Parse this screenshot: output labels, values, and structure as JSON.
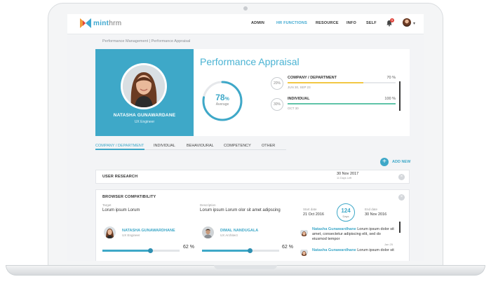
{
  "brand": {
    "name_a": "mint",
    "name_b": "hrm"
  },
  "nav": {
    "items": [
      {
        "label": "ADMIN",
        "active": false
      },
      {
        "label": "HR FUNCTIONS",
        "active": true
      },
      {
        "label": "RESOURCE",
        "active": false
      },
      {
        "label": "INFO",
        "active": false
      },
      {
        "label": "SELF",
        "active": false
      }
    ],
    "notification_count": "5",
    "caret": "▾"
  },
  "breadcrumb": "Performance Management  |  Performance Appraisal",
  "profile": {
    "name": "NATASHA GUNAWARDANE",
    "role": "UX Engineer"
  },
  "appraisal": {
    "title": "Performance Appraisal",
    "overall": {
      "value": "78",
      "unit": "%",
      "label": "Average",
      "fraction": 0.78
    },
    "rows": [
      {
        "weight": "20%",
        "title": "COMPANY / DEPARTMENT",
        "pct": "70 %",
        "fraction": 0.7,
        "dates": "JUN 30, SEP 23",
        "color": "#f2c744"
      },
      {
        "weight": "30%",
        "title": "INDIVIDUAL",
        "pct": "100 %",
        "fraction": 1.0,
        "dates": "OCT 30",
        "color": "#5fc4a8"
      }
    ]
  },
  "tabs": [
    {
      "label": "COMPANY / DEPARTMENT",
      "active": true
    },
    {
      "label": "INDIVIDUAL",
      "active": false
    },
    {
      "label": "BEHAVIOURAL",
      "active": false
    },
    {
      "label": "COMPETENCY",
      "active": false
    },
    {
      "label": "OTHER",
      "active": false
    }
  ],
  "add_new": {
    "icon": "+",
    "label": "ADD NEW"
  },
  "cards": {
    "user_research": {
      "title": "USER RESEARCH",
      "date": "30 Nov 2017",
      "sub": "11 Days Left",
      "close": "×"
    },
    "browser": {
      "title": "BROWSER COMPATIBILITY",
      "close": "×",
      "target_label": "Target",
      "target_value": "Lorum ipsum Lorum",
      "desc_label": "Description",
      "desc_value": "Lorum ipsum Lorum olor sit amet adipscing",
      "start_label": "Start date",
      "start_value": "21 Oct 2016",
      "days_value": "124",
      "days_label": "Days",
      "end_label": "End date",
      "end_value": "30 Nov 2016",
      "people": [
        {
          "name": "NATASHA GUNAWARDHANE",
          "role": "UX Engineer",
          "pct": "62 %",
          "fraction": 0.62
        },
        {
          "name": "DIMAL NANDUGALA",
          "role": "UX Architect",
          "pct": "62 %",
          "fraction": 0.62
        }
      ],
      "comments": [
        {
          "author": "Natasha Gunawardhane",
          "text": " Lorum ipsum dolor sit amet, consectetur adipiscing elit, sed do eiusmod tempor",
          "time": "Jan 25"
        },
        {
          "author": "Natasha Gunawardhane",
          "text": " Lorum ipsum dolor sit",
          "time": ""
        }
      ]
    }
  },
  "colors": {
    "accent": "#3ea8c8",
    "yellow": "#f2c744",
    "green": "#5fc4a8"
  }
}
